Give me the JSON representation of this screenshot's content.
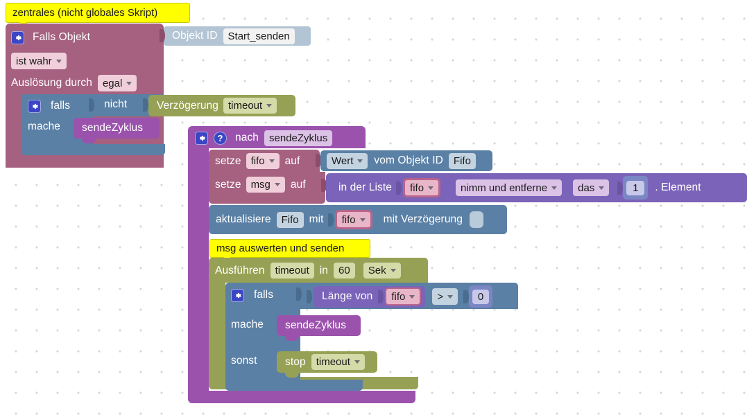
{
  "workspace": {
    "name": "blockly-workspace",
    "background": "#ffffff",
    "grid_dot_color": "#d7d7d7",
    "grid_spacing": 30
  },
  "comments": [
    {
      "id": "comment-script",
      "text": "zentrales (nicht globales Skript)",
      "color": "#ffff00"
    },
    {
      "id": "comment-msg",
      "text": "msg auswerten und senden",
      "color": "#ffff00"
    }
  ],
  "colors": {
    "mauve": "#a5617f",
    "blue": "#5b80a5",
    "olive": "#97a155",
    "purple": "#9b52ad",
    "list_purple": "#7a63b8",
    "grey_blue": "#b3c5d4",
    "math_blue": "#7b86c4",
    "comment_yellow": "#ffff00"
  },
  "blocks": {
    "falls_objekt": {
      "gear_icon": "gear-icon",
      "title": "Falls Objekt",
      "condition_dropdown": "ist wahr",
      "trigger_label": "Auslösung durch",
      "trigger_dropdown": "egal"
    },
    "objekt_id": {
      "label": "Objekt ID",
      "value": "Start_senden"
    },
    "if_not_delay": {
      "gear_icon": "gear-icon",
      "if_label": "falls",
      "not_label": "nicht",
      "delay_label": "Verzögerung",
      "delay_dropdown": "timeout",
      "do_label": "mache",
      "do_call": "sendeZyklus"
    },
    "nach_proc": {
      "gear_icon": "gear-icon",
      "help_icon": "question-icon",
      "keyword": "nach",
      "name": "sendeZyklus"
    },
    "setze_fifo": {
      "keyword": "setze",
      "variable": "fifo",
      "auf": "auf",
      "value_dropdown": "Wert",
      "value_label": "vom Objekt ID",
      "value_field": "Fifo"
    },
    "setze_msg": {
      "keyword": "setze",
      "variable": "msg",
      "auf": "auf",
      "list_label": "in der Liste",
      "list_variable": "fifo",
      "operation": "nimm und entferne",
      "position": "das",
      "index": "1",
      "element_label": ". Element"
    },
    "aktualisiere": {
      "keyword": "aktualisiere",
      "target": "Fifo",
      "mit": "mit",
      "value_variable": "fifo",
      "delay_label": "mit Verzögerung",
      "delay_value": ""
    },
    "ausfuehren": {
      "keyword": "Ausführen",
      "timer_name": "timeout",
      "in": "in",
      "interval": "60",
      "unit": "Sek"
    },
    "if_else": {
      "gear_icon": "gear-icon",
      "if_label": "falls",
      "length_label": "Länge von",
      "length_variable": "fifo",
      "comparator": ">",
      "compare_value": "0",
      "do_label": "mache",
      "do_call": "sendeZyklus",
      "else_label": "sonst",
      "else_stop": "stop",
      "else_timer": "timeout"
    }
  }
}
